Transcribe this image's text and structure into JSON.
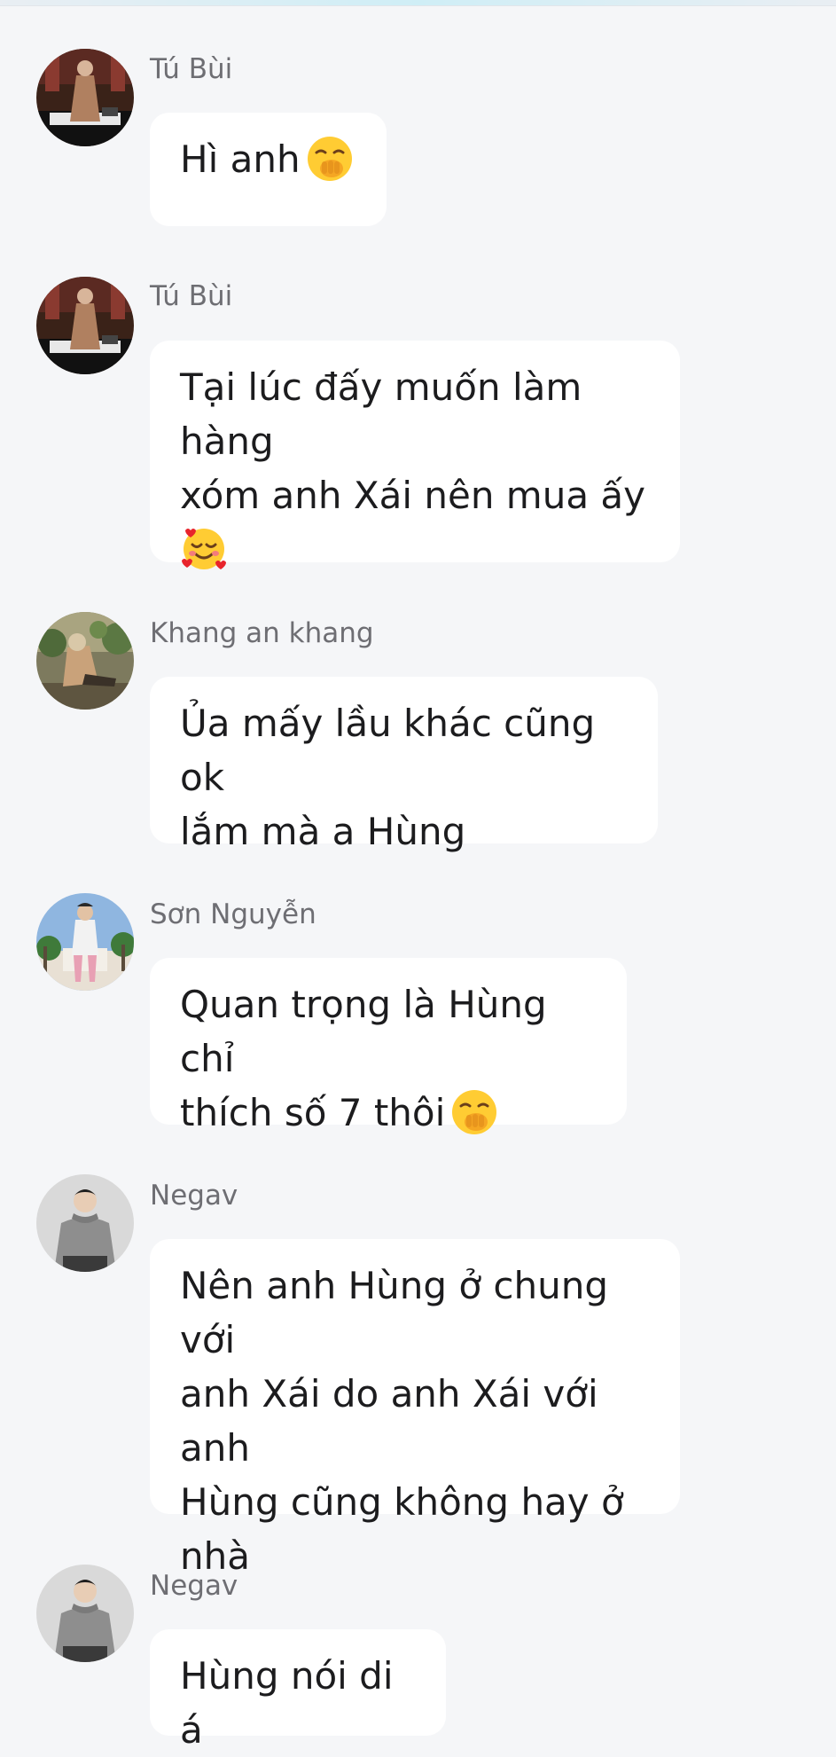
{
  "messages": [
    {
      "sender": "Tú Bùi",
      "text": "Hì anh",
      "emoji": "hand-over-mouth-emoji",
      "avatar": "tu-bui-avatar"
    },
    {
      "sender": "Tú Bùi",
      "text": "Tại lúc đấy muốn làm hàng\nxóm anh Xái nên mua ấy\n",
      "emoji": "smiling-face-with-hearts-emoji",
      "avatar": "tu-bui-avatar"
    },
    {
      "sender": "Khang an khang",
      "text": "Ủa mấy lầu khác cũng ok\nlắm mà a Hùng",
      "avatar": "khang-avatar"
    },
    {
      "sender": "Sơn Nguyễn",
      "text": "Quan trọng là Hùng chỉ\nthích số 7 thôi",
      "emoji": "hand-over-mouth-emoji",
      "avatar": "son-nguyen-avatar"
    },
    {
      "sender": "Negav",
      "text": "Nên anh Hùng ở chung với\nanh Xái do anh Xái với anh\nHùng cũng không hay ở\nnhà",
      "avatar": "negav-avatar"
    },
    {
      "sender": "Negav",
      "text": "Hùng nói di á",
      "avatar": "negav-avatar"
    }
  ],
  "colors": {
    "background": "#f5f6f8",
    "bubble": "#ffffff",
    "sender_text": "#6e6e73",
    "message_text": "#1c1c1e"
  }
}
